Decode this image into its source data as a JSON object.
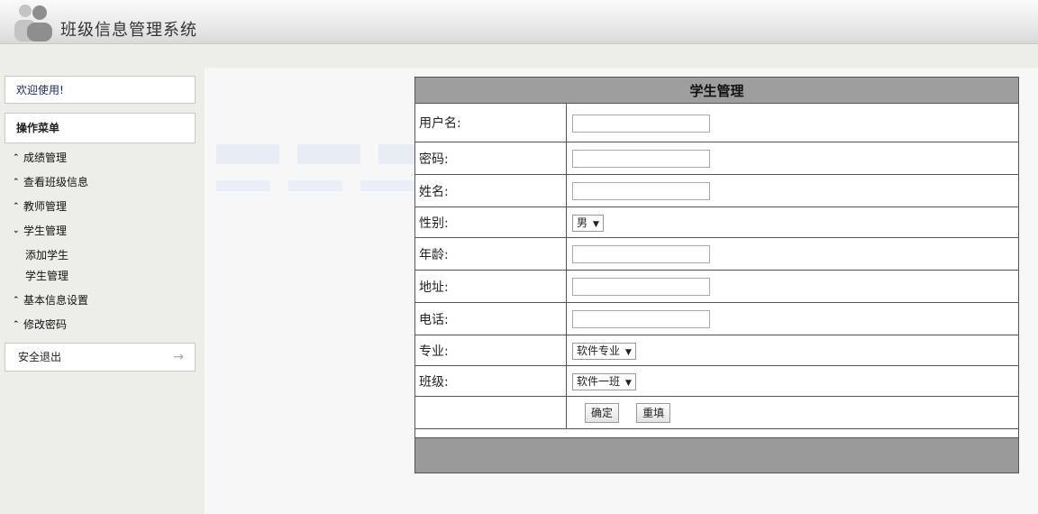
{
  "header": {
    "title": "班级信息管理系统"
  },
  "sidebar": {
    "welcome": "欢迎使用!",
    "menu_title": "操作菜单",
    "items": [
      {
        "label": "成绩管理",
        "chevron": "^"
      },
      {
        "label": "查看班级信息",
        "chevron": "^"
      },
      {
        "label": "教师管理",
        "chevron": "^"
      },
      {
        "label": "学生管理",
        "chevron": "v",
        "expanded": true,
        "children": [
          {
            "label": "添加学生"
          },
          {
            "label": "学生管理"
          }
        ]
      },
      {
        "label": "基本信息设置",
        "chevron": "^"
      },
      {
        "label": "修改密码",
        "chevron": "^"
      }
    ],
    "logout": "安全退出"
  },
  "form": {
    "title": "学生管理",
    "fields": {
      "username": {
        "label": "用户名:",
        "value": ""
      },
      "password": {
        "label": "密码:",
        "value": ""
      },
      "name": {
        "label": "姓名:",
        "value": ""
      },
      "gender": {
        "label": "性别:",
        "value": "男"
      },
      "age": {
        "label": "年龄:",
        "value": ""
      },
      "address": {
        "label": "地址:",
        "value": ""
      },
      "phone": {
        "label": "电话:",
        "value": ""
      },
      "major": {
        "label": "专业:",
        "value": "软件专业"
      },
      "class": {
        "label": "班级:",
        "value": "软件一班"
      }
    },
    "confirm_label": "确定",
    "reset_label": "重填"
  },
  "icons": {
    "logo": "users-icon",
    "logout": "arrow-right-icon"
  }
}
